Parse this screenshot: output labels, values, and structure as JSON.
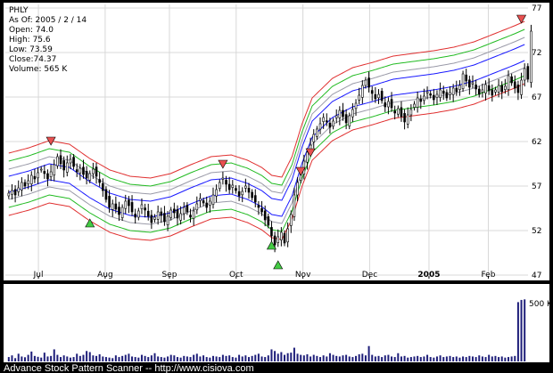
{
  "stock_info": {
    "symbol": "PHLY",
    "as_of": "As Of: 2005 / 2 / 14",
    "open": "Open: 74.0",
    "high": "High: 75.6",
    "low": "Low: 73.59",
    "close": "Close:74.37",
    "volume": "Volume: 565 K"
  },
  "footer": "Advance Stock Pattern Scanner -- http://www.cisiova.com",
  "volume_label": "500 K",
  "colors": {
    "background": "#000000",
    "panel": "#ffffff",
    "candle": "#000000",
    "blue_band": "#1a1aff",
    "gray_band": "#9a9aa8",
    "green_band": "#22bb22",
    "red_band": "#e03030",
    "volume_bar": "#1f1f7a",
    "buy_arrow": "#44cc44",
    "sell_arrow": "#e85050"
  },
  "chart_data": {
    "type": "candlestick",
    "ylim": [
      47,
      77
    ],
    "yticks": [
      "77",
      "72",
      "67",
      "62",
      "57",
      "52",
      "47"
    ],
    "month_labels": [
      "Jul",
      "Aug",
      "Sep",
      "Oct",
      "Nov",
      "Dec",
      "2005",
      "Feb"
    ],
    "n_days": 160,
    "center_line": [
      [
        0,
        57.2
      ],
      [
        10,
        57.8
      ],
      [
        20,
        58.6
      ],
      [
        30,
        58.2
      ],
      [
        40,
        56.6
      ],
      [
        50,
        55.3
      ],
      [
        60,
        54.6
      ],
      [
        70,
        54.4
      ],
      [
        80,
        54.9
      ],
      [
        90,
        55.9
      ],
      [
        100,
        56.8
      ],
      [
        110,
        57.0
      ],
      [
        118,
        56.4
      ],
      [
        125,
        55.6
      ],
      [
        130,
        54.7
      ],
      [
        135,
        54.5
      ],
      [
        140,
        56.8
      ],
      [
        145,
        60.5
      ],
      [
        150,
        63.4
      ],
      [
        160,
        65.6
      ],
      [
        170,
        66.8
      ],
      [
        180,
        67.4
      ],
      [
        190,
        68.1
      ],
      [
        200,
        68.4
      ],
      [
        210,
        68.7
      ],
      [
        220,
        69.1
      ],
      [
        230,
        69.7
      ],
      [
        240,
        70.6
      ],
      [
        250,
        71.5
      ],
      [
        255,
        72.0
      ]
    ],
    "band_offsets": [
      -2.6,
      -1.7,
      -0.9,
      0.9,
      1.7,
      2.6
    ],
    "day_map_note": "x positions for 256 sample points mapped onto 160 trading days",
    "ohlc_close": [
      56.2,
      56.5,
      56.0,
      56.8,
      57.4,
      57.0,
      57.6,
      58.2,
      57.8,
      58.5,
      58.9,
      58.4,
      57.8,
      58.6,
      59.4,
      60.3,
      59.5,
      58.8,
      59.6,
      60.0,
      59.2,
      58.6,
      59.0,
      58.3,
      57.9,
      58.4,
      58.9,
      58.1,
      57.4,
      56.5,
      55.5,
      54.6,
      55.0,
      54.4,
      53.8,
      54.6,
      55.3,
      54.8,
      54.1,
      53.5,
      54.2,
      54.9,
      54.3,
      53.6,
      52.9,
      53.5,
      54.1,
      53.7,
      53.0,
      53.6,
      54.3,
      54.0,
      53.4,
      53.9,
      54.6,
      54.1,
      53.5,
      54.2,
      55.0,
      55.6,
      55.1,
      54.6,
      55.3,
      56.0,
      56.6,
      57.4,
      57.9,
      57.2,
      56.6,
      57.1,
      56.5,
      55.9,
      56.4,
      57.0,
      56.3,
      55.7,
      55.2,
      54.6,
      54.1,
      53.2,
      52.6,
      51.4,
      50.4,
      51.3,
      51.8,
      50.6,
      52.2,
      53.8,
      56.0,
      57.4,
      58.7,
      59.8,
      60.8,
      61.6,
      62.8,
      63.4,
      64.0,
      64.7,
      64.2,
      63.6,
      64.3,
      64.9,
      65.5,
      64.8,
      64.1,
      64.9,
      65.6,
      66.3,
      67.2,
      68.3,
      68.9,
      68.1,
      67.4,
      66.8,
      67.3,
      66.6,
      65.9,
      66.5,
      65.8,
      65.2,
      65.7,
      64.8,
      64.2,
      65.0,
      65.6,
      66.2,
      66.9,
      66.5,
      67.1,
      67.6,
      67.2,
      66.7,
      67.3,
      67.8,
      67.4,
      66.9,
      67.5,
      68.0,
      67.6,
      68.3,
      69.6,
      68.8,
      68.1,
      68.6,
      67.9,
      67.3,
      67.8,
      68.4,
      67.7,
      67.2,
      67.8,
      68.3,
      67.6,
      68.2,
      69.4,
      68.6,
      68.0,
      67.5,
      68.9,
      70.2,
      69.0,
      74.4
    ],
    "arrows_up": [
      [
        25,
        53.3
      ],
      [
        81,
        50.8
      ],
      [
        83,
        48.6
      ]
    ],
    "arrows_down": [
      [
        13,
        61.6
      ],
      [
        66,
        59.0
      ],
      [
        90,
        58.2
      ],
      [
        93,
        60.3
      ],
      [
        158,
        75.3
      ]
    ],
    "volume_scale_max": 600,
    "volume_label_value": 500,
    "volume_k": [
      40,
      55,
      30,
      70,
      45,
      38,
      60,
      90,
      50,
      42,
      35,
      80,
      45,
      50,
      110,
      60,
      40,
      55,
      45,
      35,
      40,
      70,
      50,
      60,
      95,
      85,
      55,
      50,
      65,
      45,
      40,
      35,
      30,
      55,
      40,
      50,
      60,
      70,
      45,
      40,
      35,
      60,
      50,
      40,
      55,
      75,
      45,
      40,
      35,
      45,
      60,
      55,
      40,
      35,
      50,
      45,
      40,
      60,
      70,
      45,
      55,
      40,
      35,
      50,
      45,
      40,
      60,
      50,
      55,
      40,
      35,
      60,
      45,
      55,
      40,
      50,
      60,
      70,
      45,
      40,
      55,
      110,
      95,
      70,
      85,
      60,
      75,
      80,
      125,
      70,
      60,
      55,
      65,
      45,
      60,
      50,
      40,
      55,
      45,
      75,
      60,
      50,
      45,
      55,
      60,
      45,
      40,
      50,
      65,
      70,
      55,
      140,
      60,
      45,
      50,
      40,
      55,
      60,
      45,
      40,
      75,
      45,
      50,
      35,
      40,
      45,
      50,
      40,
      45,
      60,
      40,
      35,
      45,
      55,
      40,
      45,
      50,
      40,
      45,
      35,
      45,
      40,
      50,
      45,
      40,
      55,
      45,
      40,
      60,
      45,
      50,
      40,
      45,
      35,
      40,
      45,
      50,
      540,
      560,
      565
    ]
  }
}
